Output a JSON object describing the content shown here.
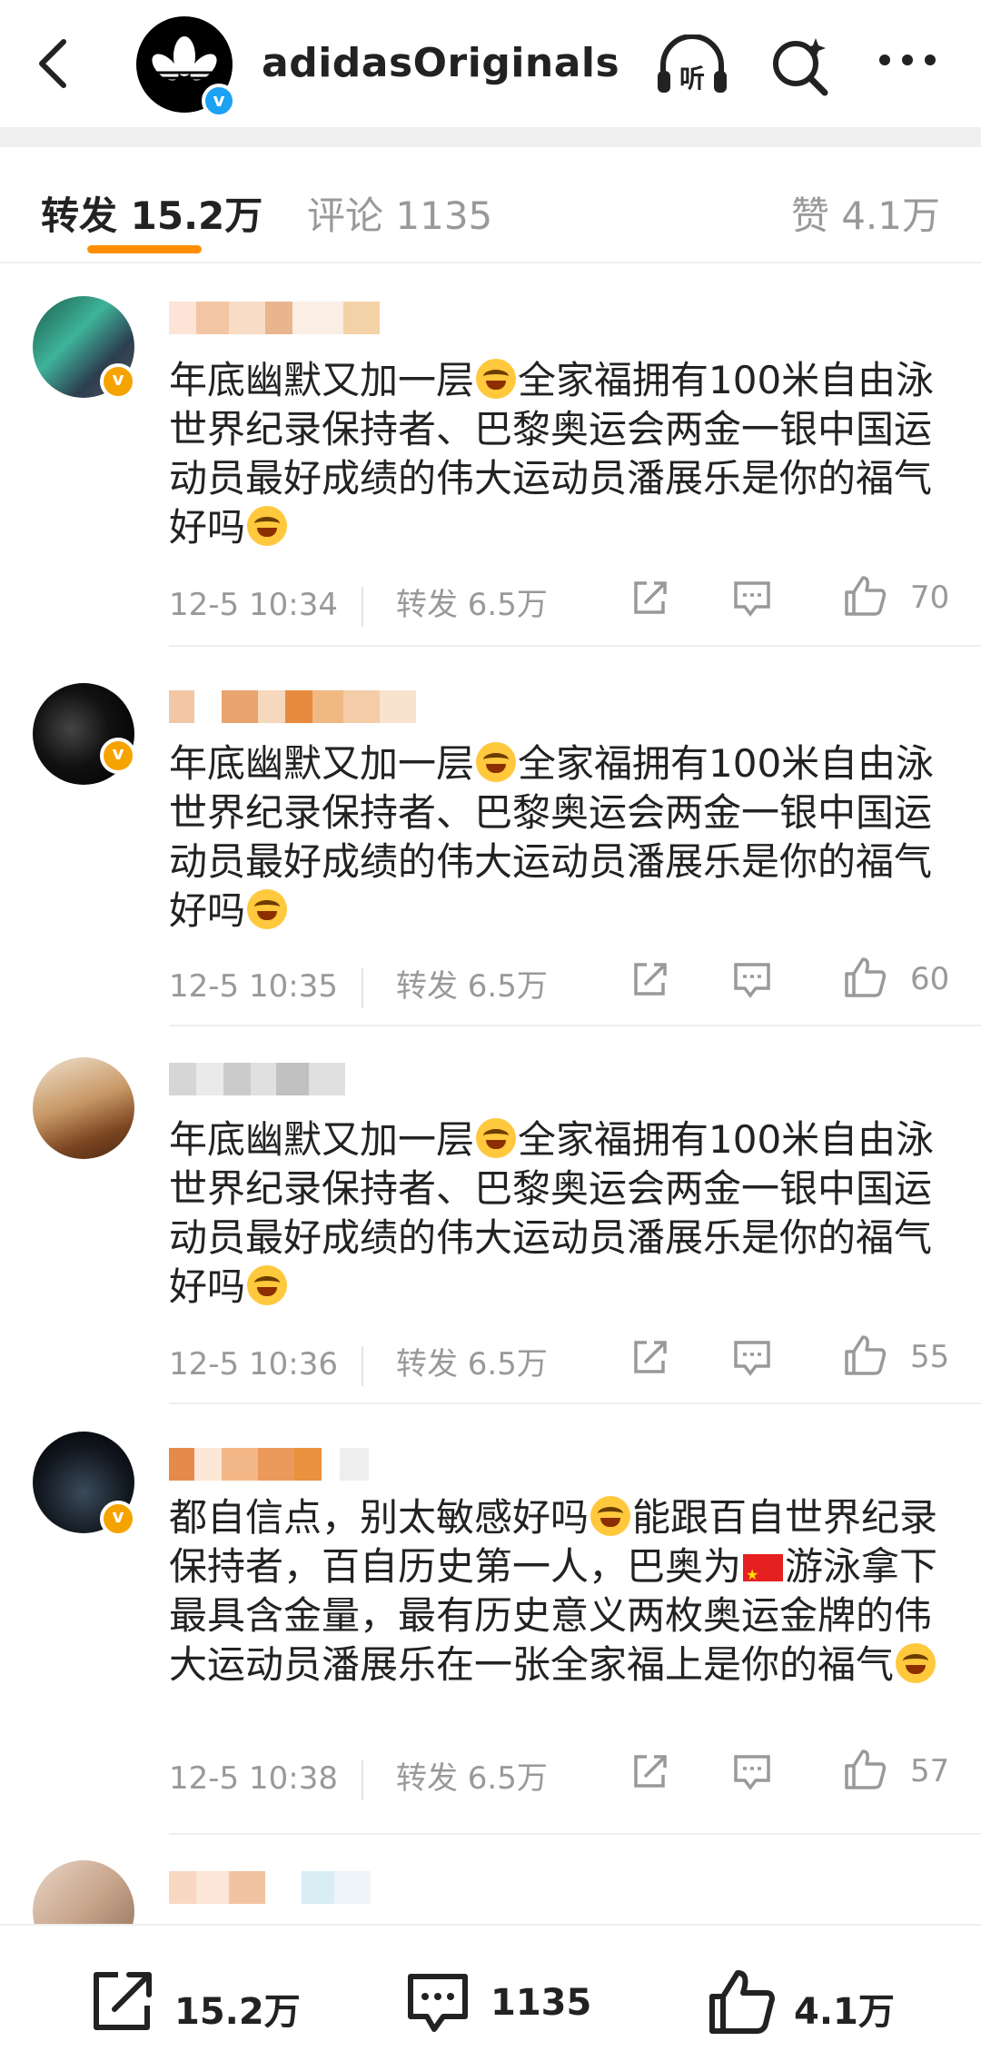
{
  "header": {
    "back_icon": "chevron-left-icon",
    "account_name": "adidasOriginals",
    "listen_label": "听",
    "search_icon": "search-sparkle-icon",
    "more_icon": "more-dots-icon"
  },
  "tabs": {
    "repost_label": "转发",
    "repost_count": "15.2万",
    "comment_label": "评论",
    "comment_count": "1135",
    "like_label": "赞",
    "like_count": "4.1万"
  },
  "comments": [
    {
      "text_before": "年底幽默又加一层",
      "text_middle": "全家福拥有100米自由泳世界纪录保持者、巴黎奥运会两金一银中国运动员最好成绩的伟大运动员潘展乐是你的福气好吗",
      "time": "12-5 10:34",
      "repost": "转发 6.5万",
      "likes": "70"
    },
    {
      "text_before": "年底幽默又加一层",
      "text_middle": "全家福拥有100米自由泳世界纪录保持者、巴黎奥运会两金一银中国运动员最好成绩的伟大运动员潘展乐是你的福气好吗",
      "time": "12-5 10:35",
      "repost": "转发 6.5万",
      "likes": "60"
    },
    {
      "text_before": "年底幽默又加一层",
      "text_middle": "全家福拥有100米自由泳世界纪录保持者、巴黎奥运会两金一银中国运动员最好成绩的伟大运动员潘展乐是你的福气好吗",
      "time": "12-5 10:36",
      "repost": "转发 6.5万",
      "likes": "55"
    },
    {
      "text_before": "都自信点，别太敏感好吗",
      "text_middle": "能跟百自世界纪录保持者，百自历史第一人，巴奥为",
      "text_after": "游泳拿下最具含金量，最有历史意义两枚奥运金牌的伟大运动员潘展乐在一张全家福上是你的福气",
      "time": "12-5 10:38",
      "repost": "转发 6.5万",
      "likes": "57"
    }
  ],
  "bottom_bar": {
    "repost_count": "15.2万",
    "comment_count": "1135",
    "like_count": "4.1万"
  },
  "colors": {
    "accent": "#ff8f00",
    "verified_blue": "#1da1f2",
    "verified_gold": "#f5a300",
    "muted_text": "#999999"
  }
}
